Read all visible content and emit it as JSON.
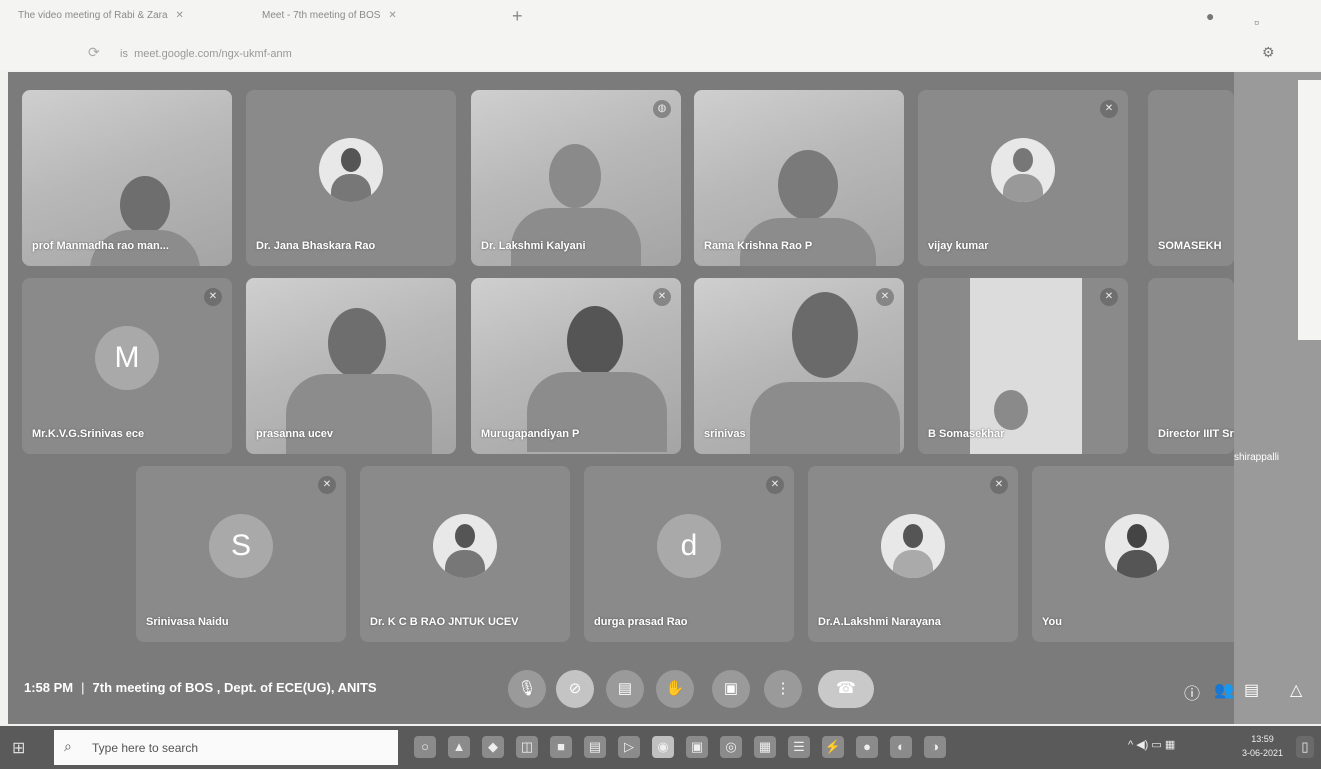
{
  "browser": {
    "tabs": [
      {
        "label": "The video meeting of Rabi & Zara"
      },
      {
        "label": "Meet - 7th meeting of BOS"
      }
    ],
    "new_tab": "+",
    "url": "meet.google.com/ngx-ukmf-anm",
    "url_prefix": "is"
  },
  "meeting": {
    "time": "1:58 PM",
    "separator": "|",
    "title": "7th meeting of BOS , Dept. of ECE(UG), ANITS"
  },
  "participants": [
    {
      "name": "prof Manmadha rao man...",
      "type": "video",
      "muted": false
    },
    {
      "name": "Dr. Jana Bhaskara Rao",
      "type": "photo",
      "muted": false
    },
    {
      "name": "Dr. Lakshmi Kalyani",
      "type": "video",
      "muted": false
    },
    {
      "name": "Rama Krishna Rao P",
      "type": "video",
      "muted": false
    },
    {
      "name": "vijay kumar",
      "type": "photo",
      "muted": true
    },
    {
      "name": "SOMASEKH",
      "type": "partial",
      "muted": false
    },
    {
      "name": "Mr.K.V.G.Srinivas ece",
      "type": "letter",
      "letter": "M",
      "muted": true
    },
    {
      "name": "prasanna ucev",
      "type": "video",
      "muted": false
    },
    {
      "name": "Murugapandiyan P",
      "type": "video",
      "muted": true
    },
    {
      "name": "srinivas",
      "type": "video",
      "muted": true
    },
    {
      "name": "B Somasekhar",
      "type": "video",
      "muted": true
    },
    {
      "name": "Director IIIT Srikakulam",
      "type": "partial",
      "muted": false
    },
    {
      "name": "Srinivasa Naidu",
      "type": "letter",
      "letter": "S",
      "muted": true
    },
    {
      "name": "Dr. K C B RAO JNTUK UCEV",
      "type": "photo",
      "muted": false
    },
    {
      "name": "durga prasad Rao",
      "type": "letter",
      "letter": "d",
      "muted": true
    },
    {
      "name": "Dr.A.Lakshmi Narayana",
      "type": "photo",
      "muted": true
    },
    {
      "name": "You",
      "type": "photo",
      "muted": false
    }
  ],
  "controls": {
    "mic_icon": "🎙",
    "cam_icon": "⊘",
    "captions_icon": "▤",
    "hand_icon": "✋",
    "present_icon": "▣",
    "more_icon": "⋮",
    "end_icon": "☎"
  },
  "right_controls": {
    "info_icon": "ⓘ",
    "people_icon": "👥",
    "chat_icon": "▤",
    "activities_icon": "△"
  },
  "taskbar": {
    "search_placeholder": "Type here to search",
    "clock_time": "13:59",
    "clock_date": "3-06-2021"
  },
  "right_window_partial_text": "shirappalli"
}
